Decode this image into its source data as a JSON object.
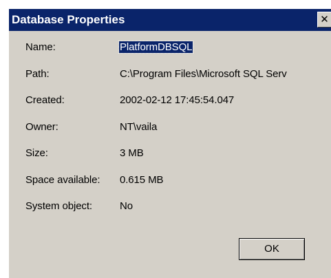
{
  "window": {
    "title": "Database Properties",
    "close_glyph": "✕",
    "close_icon": "close-icon"
  },
  "properties": [
    {
      "label": "Name:",
      "value": "PlatformDBSQL"
    },
    {
      "label": "Path:",
      "value": "C:\\Program Files\\Microsoft SQL Serv"
    },
    {
      "label": "Created:",
      "value": "2002-02-12 17:45:54.047"
    },
    {
      "label": "Owner:",
      "value": "NT\\vaila"
    },
    {
      "label": "Size:",
      "value": "3 MB"
    },
    {
      "label": "Space available:",
      "value": "0.615 MB"
    },
    {
      "label": "System object:",
      "value": "No"
    }
  ],
  "buttons": {
    "ok_label": "OK"
  },
  "colors": {
    "titlebar": "#0a246a",
    "dialog_face": "#d4d0c8",
    "selection": "#0a246a"
  }
}
